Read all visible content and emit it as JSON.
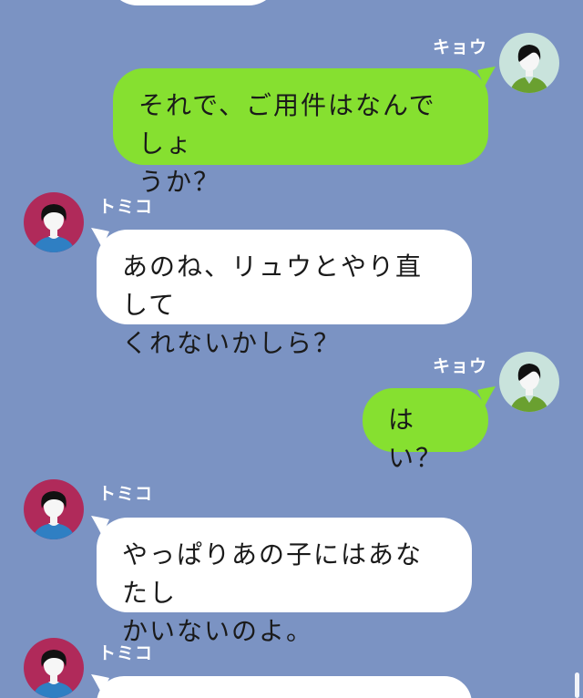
{
  "colors": {
    "background": "#7b93c3",
    "incoming_bubble": "#ffffff",
    "outgoing_bubble": "#86e030",
    "name_text": "#ffffff"
  },
  "messages": [
    {
      "sender": "キョウ",
      "side": "right",
      "avatar": "kyou-avatar-icon",
      "lines": [
        "それで、ご用件はなんでしょ",
        "うか？"
      ]
    },
    {
      "sender": "トミコ",
      "side": "left",
      "avatar": "tomiko-avatar-icon",
      "lines": [
        "あのね、リュウとやり直して",
        "くれないかしら？"
      ]
    },
    {
      "sender": "キョウ",
      "side": "right",
      "avatar": "kyou-avatar-icon",
      "lines": [
        "はい？"
      ]
    },
    {
      "sender": "トミコ",
      "side": "left",
      "avatar": "tomiko-avatar-icon",
      "lines": [
        "やっぱりあの子にはあなたし",
        "かいないのよ。"
      ]
    },
    {
      "sender": "トミコ",
      "side": "left",
      "avatar": "tomiko-avatar-icon",
      "lines": []
    }
  ]
}
